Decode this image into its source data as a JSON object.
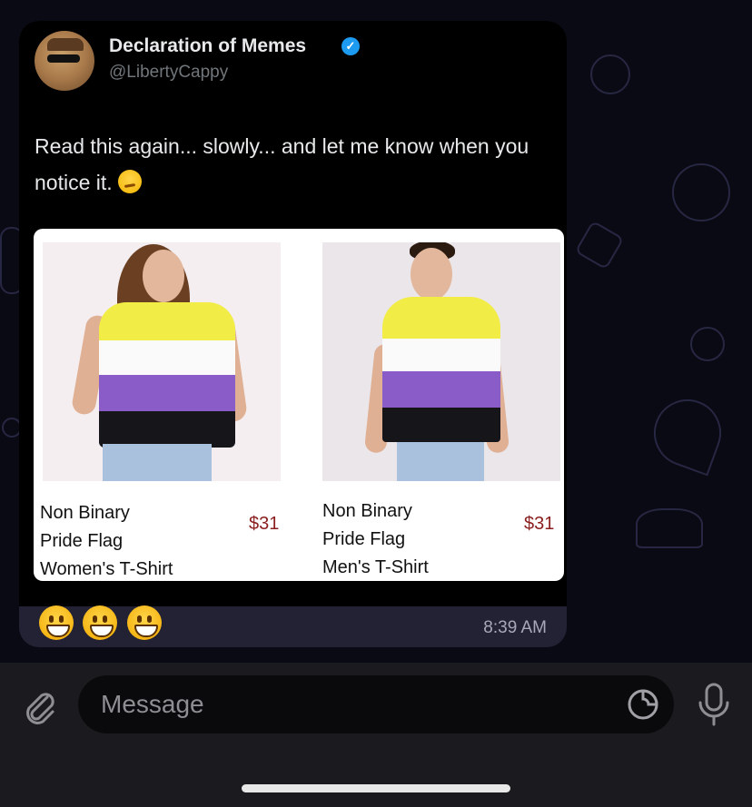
{
  "tweet": {
    "author_name": "Declaration of Memes",
    "handle": "@LibertyCappy",
    "text": "Read this again... slowly... and let me know when you notice it."
  },
  "products": [
    {
      "name": "Non Binary\nPride Flag\nWomen's T-Shirt",
      "price": "$31"
    },
    {
      "name": "Non Binary\nPride Flag\nMen's T-Shirt",
      "price": "$31"
    }
  ],
  "message": {
    "reaction_emojis": [
      "grinning-face",
      "grinning-face",
      "grinning-face"
    ],
    "time": "8:39 AM"
  },
  "composer": {
    "placeholder": "Message"
  },
  "colors": {
    "bubble": "#232234",
    "flag_yellow": "#f2ec46",
    "flag_white": "#fafafa",
    "flag_purple": "#8a5cc8",
    "flag_black": "#16161a",
    "price": "#8a1e1e"
  }
}
